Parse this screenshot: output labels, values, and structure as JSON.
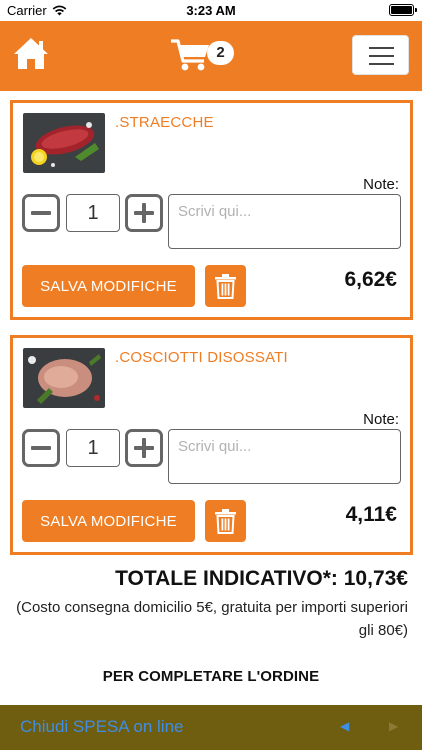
{
  "status_bar": {
    "carrier": "Carrier",
    "time": "3:23 AM"
  },
  "header": {
    "cart_count": "2"
  },
  "products": [
    {
      "name": ".STRAECCHE",
      "note_label": "Note:",
      "quantity": "1",
      "note_placeholder": "Scrivi qui...",
      "save_label": "SALVA MODIFICHE",
      "price": "6,62€"
    },
    {
      "name": ".COSCIOTTI DISOSSATI",
      "note_label": "Note:",
      "quantity": "1",
      "note_placeholder": "Scrivi qui...",
      "save_label": "SALVA MODIFICHE",
      "price": "4,11€"
    }
  ],
  "summary": {
    "total": "TOTALE INDICATIVO*: 10,73€",
    "delivery_note": "(Costo consegna domicilio 5€, gratuita per importi superiori gli 80€)",
    "complete_label": "PER COMPLETARE L'ORDINE"
  },
  "bottom_bar": {
    "link_label": "Chiudi SPESA on line",
    "back_icon": "◀",
    "forward_icon": "▶"
  },
  "colors": {
    "accent": "#ee7d23",
    "bottom_bar": "#6f5d10",
    "link": "#3d8ee6"
  }
}
